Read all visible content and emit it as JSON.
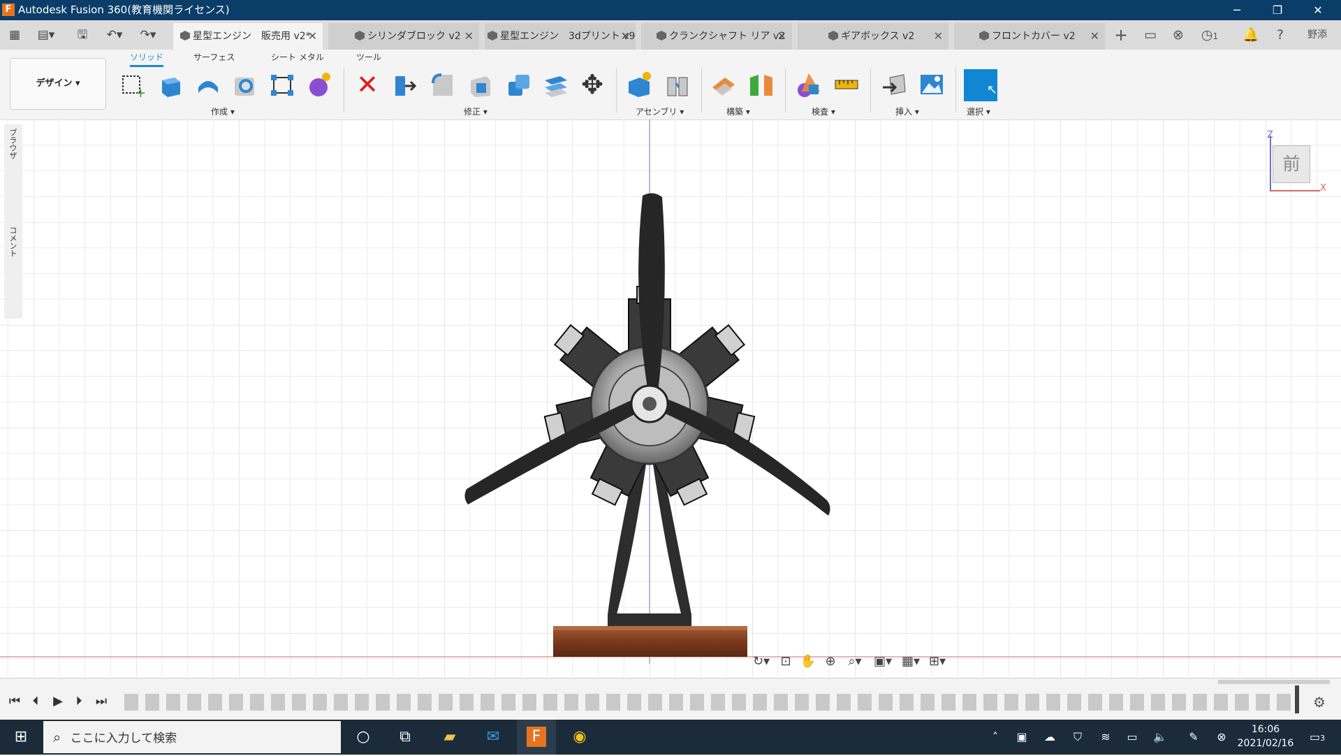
{
  "window": {
    "title": "Autodesk Fusion 360(教育機関ライセンス)",
    "app_icon": "F",
    "controls": [
      "─",
      "❐",
      "✕"
    ]
  },
  "tabs": [
    {
      "label": "星型エンジン　販売用 v2*",
      "active": true
    },
    {
      "label": "シリンダブロック v2",
      "active": false
    },
    {
      "label": "星型エンジン　3dプリント v9",
      "active": false
    },
    {
      "label": "クランクシャフト リア v2",
      "active": false
    },
    {
      "label": "ギアボックス v2",
      "active": false
    },
    {
      "label": "フロントカバー v2",
      "active": false
    }
  ],
  "header_right": {
    "job_count": "1",
    "user": "野添"
  },
  "workspace": {
    "label": "デザイン"
  },
  "subtabs": [
    "ソリッド",
    "サーフェス",
    "シート メタル",
    "ツール"
  ],
  "groups": [
    "作成",
    "修正",
    "アセンブリ",
    "構築",
    "検査",
    "挿入",
    "選択"
  ],
  "side_panel": {
    "browser": "ブラウザ",
    "comments": "コメント"
  },
  "viewcube": {
    "face": "前",
    "z": "Z",
    "x": "X"
  },
  "taskbar": {
    "search_placeholder": "ここに入力して検索",
    "time": "16:06",
    "date": "2021/02/16",
    "notifications": "3"
  },
  "colors": {
    "titlebar": "#0a3d67",
    "accent": "#1e88c8",
    "select_button": "#1187d4",
    "grid": "#d7d7d7",
    "base_wood": "#7b3a1e",
    "taskbar": "#1b2b3a"
  },
  "icons": {
    "close_tab": "close-icon",
    "grid_menu": "app-grid-icon",
    "save": "save-icon"
  }
}
